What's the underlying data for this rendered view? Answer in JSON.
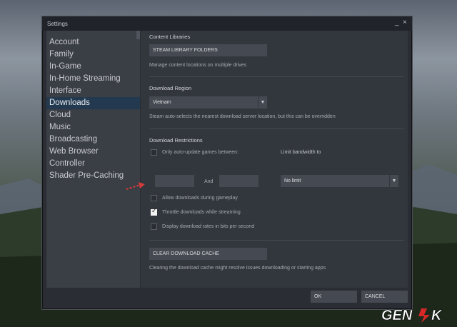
{
  "window": {
    "title": "Settings",
    "minimize_glyph": "_",
    "close_glyph": "×"
  },
  "sidebar": {
    "items": [
      {
        "label": "Account"
      },
      {
        "label": "Family"
      },
      {
        "label": "In-Game"
      },
      {
        "label": "In-Home Streaming"
      },
      {
        "label": "Interface"
      },
      {
        "label": "Downloads"
      },
      {
        "label": "Cloud"
      },
      {
        "label": "Music"
      },
      {
        "label": "Broadcasting"
      },
      {
        "label": "Web Browser"
      },
      {
        "label": "Controller"
      },
      {
        "label": "Shader Pre-Caching"
      }
    ],
    "selected": "Downloads"
  },
  "content_libraries": {
    "heading": "Content Libraries",
    "button": "STEAM LIBRARY FOLDERS",
    "description": "Manage content locations on multiple drives"
  },
  "download_region": {
    "heading": "Download Region",
    "selected": "Vietnam",
    "description": "Steam auto-selects the nearest download server location, but this can be overridden"
  },
  "download_restrictions": {
    "heading": "Download Restrictions",
    "only_auto_update_label": "Only auto-update games between:",
    "and_label": "And",
    "limit_bandwidth_label": "Limit bandwidth to",
    "bandwidth_selected": "No limit",
    "allow_during_gameplay_label": "Allow downloads during gameplay",
    "throttle_label": "Throttle downloads while streaming",
    "bits_label": "Display download rates in bits per second",
    "checkboxes": {
      "only_auto_update": false,
      "allow_during_gameplay": false,
      "throttle": true,
      "bits": false
    }
  },
  "cache": {
    "button": "CLEAR DOWNLOAD CACHE",
    "description": "Clearing the download cache might resolve issues downloading or starting apps"
  },
  "footer": {
    "ok": "OK",
    "cancel": "CANCEL"
  },
  "watermark": {
    "text": "GENK"
  },
  "colors": {
    "selected_nav": "#22394f",
    "panel": "#32363d",
    "sidebar": "#3a3e45"
  },
  "icons": {
    "dropdown": "chevron-down-icon",
    "annotation": "arrow-right-icon",
    "check": "check-icon"
  }
}
